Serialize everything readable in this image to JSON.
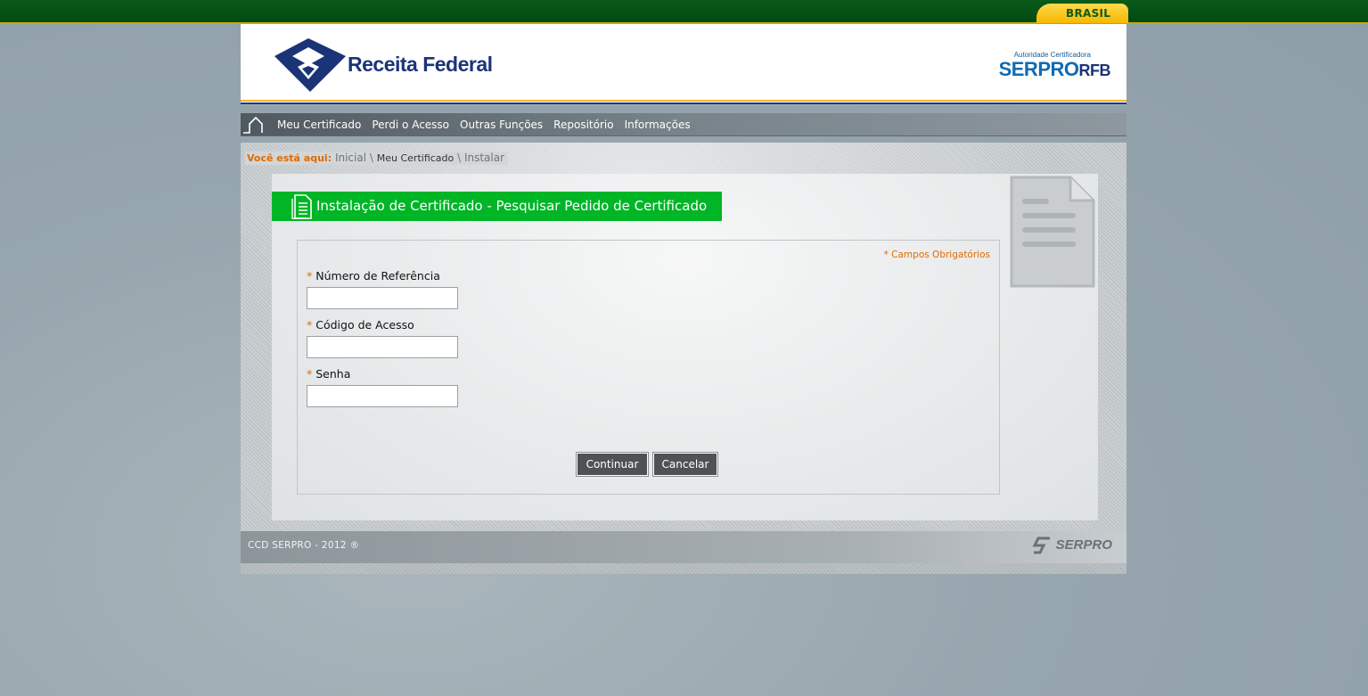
{
  "gov_bar": {
    "brasil_label": "BRASIL"
  },
  "header": {
    "brand": "Receita Federal",
    "ca_caption": "Autoridade Certificadora",
    "ca_brand_main": "SERPRO",
    "ca_brand_suffix": "RFB"
  },
  "nav": {
    "items": [
      {
        "label": "Meu Certificado"
      },
      {
        "label": "Perdi o Acesso"
      },
      {
        "label": "Outras Funções"
      },
      {
        "label": "Repositório"
      },
      {
        "label": "Informações"
      }
    ]
  },
  "breadcrumb": {
    "prefix": "Você está aqui:",
    "item1": "Inicial",
    "sep": "\\",
    "item2": "Meu Certificado",
    "item3": "Instalar"
  },
  "page": {
    "title": "Instalação de Certificado - Pesquisar Pedido de Certificado",
    "required_note": "* Campos Obrigatórios"
  },
  "form": {
    "required_mark": "*",
    "fields": [
      {
        "label": "Número de Referência",
        "value": "",
        "placeholder": ""
      },
      {
        "label": "Código de Acesso",
        "value": "",
        "placeholder": ""
      },
      {
        "label": "Senha",
        "value": "",
        "placeholder": ""
      }
    ],
    "continue_label": "Continuar",
    "cancel_label": "Cancelar"
  },
  "footer": {
    "copyright": "CCD SERPRO - 2012 ®",
    "logo_text": "SERPRO"
  },
  "colors": {
    "gov_green": "#004a12",
    "brand_blue": "#1b3478",
    "title_green": "#00b526",
    "accent_orange": "#e06b00",
    "button_gray": "#4f5255"
  }
}
